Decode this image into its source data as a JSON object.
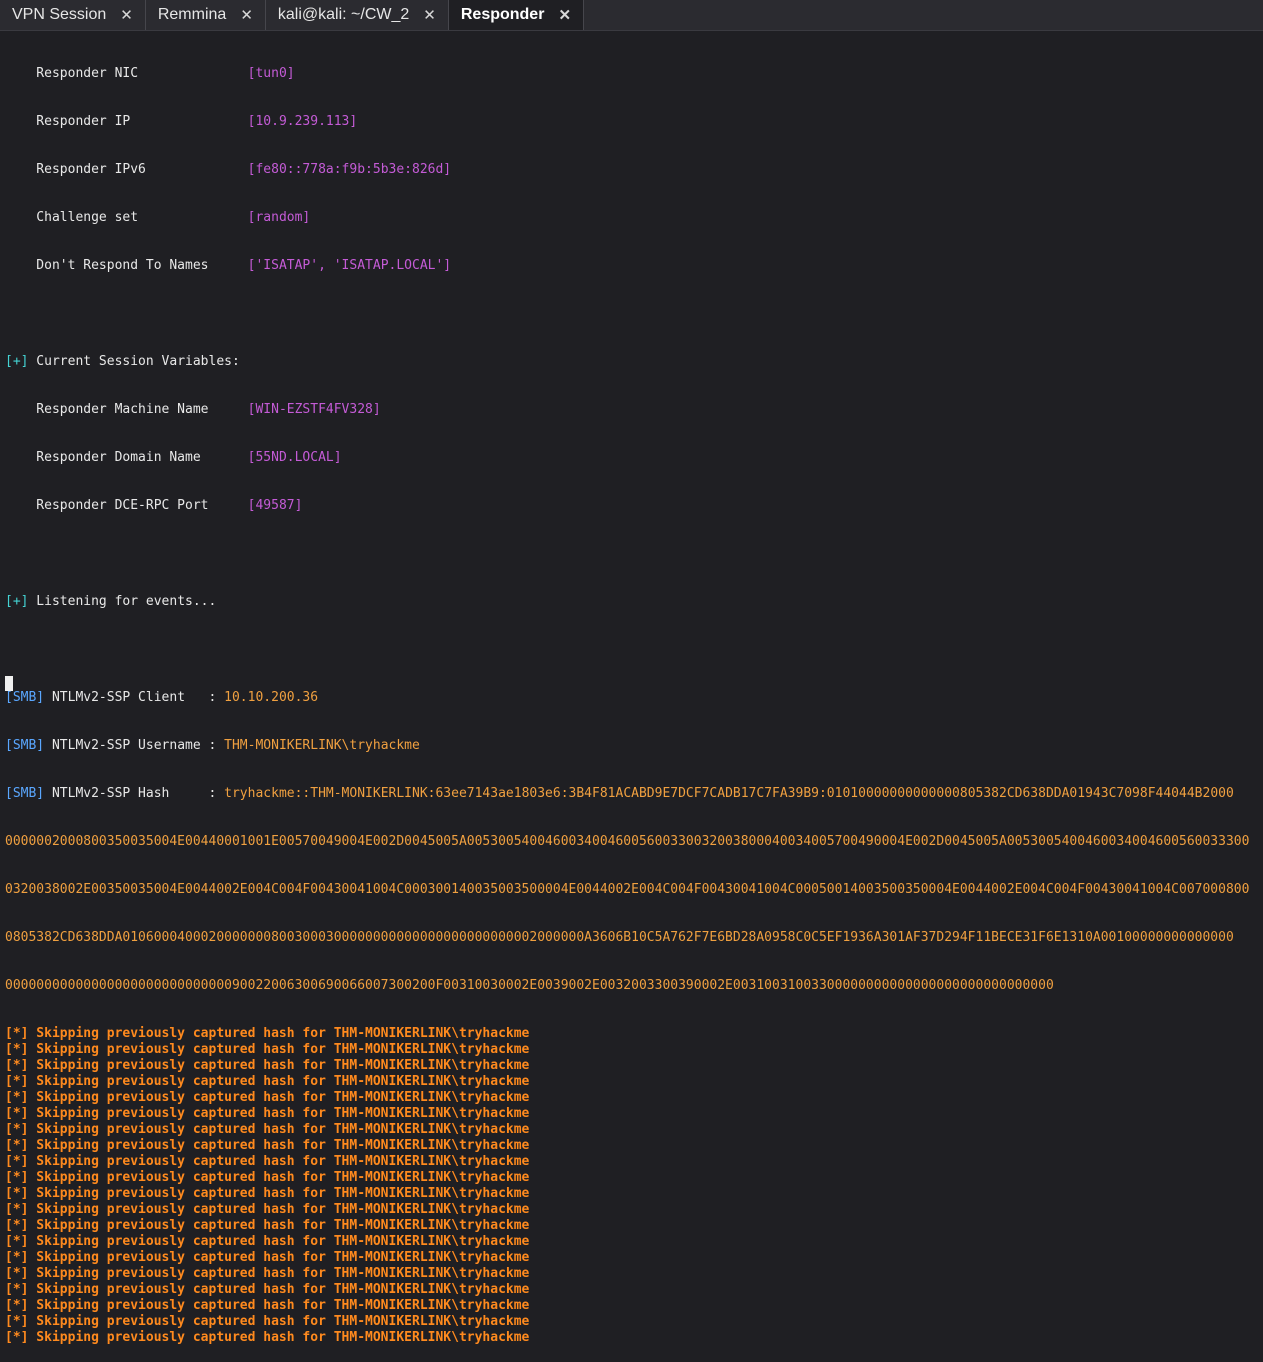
{
  "tabs": [
    {
      "label": "VPN Session",
      "active": false
    },
    {
      "label": "Remmina",
      "active": false
    },
    {
      "label": "kali@kali: ~/CW_2",
      "active": false
    },
    {
      "label": "Responder",
      "active": true
    }
  ],
  "close_glyph": "✕",
  "terminal": {
    "settings": [
      {
        "label": "    Responder NIC              ",
        "value": "[tun0]"
      },
      {
        "label": "    Responder IP               ",
        "value": "[10.9.239.113]"
      },
      {
        "label": "    Responder IPv6             ",
        "value": "[fe80::778a:f9b:5b3e:826d]"
      },
      {
        "label": "    Challenge set              ",
        "value": "[random]"
      },
      {
        "label": "    Don't Respond To Names     ",
        "value": "['ISATAP', 'ISATAP.LOCAL']"
      }
    ],
    "session_header_prefix": "[+]",
    "session_header_text": " Current Session Variables:",
    "session_vars": [
      {
        "label": "    Responder Machine Name     ",
        "value": "[WIN-EZSTF4FV328]"
      },
      {
        "label": "    Responder Domain Name      ",
        "value": "[55ND.LOCAL]"
      },
      {
        "label": "    Responder DCE-RPC Port     ",
        "value": "[49587]"
      }
    ],
    "listening_prefix": "[+]",
    "listening_text": " Listening for events...",
    "smb_tag": "[SMB]",
    "smb_client_label": " NTLMv2-SSP Client   : ",
    "smb_client_value": "10.10.200.36",
    "smb_user_label": " NTLMv2-SSP Username : ",
    "smb_user_value": "THM-MONIKERLINK\\tryhackme",
    "smb_hash_label": " NTLMv2-SSP Hash     : ",
    "hash_lines": [
      "tryhackme::THM-MONIKERLINK:63ee7143ae1803e6:3B4F81ACABD9E7DCF7CADB17C7FA39B9:01010000000000000805382CD638DDA01943C7098F44044B2000",
      "0000002000800350035004E00440001001E00570049004E002D0045005A00530054004600340046005600330032003800040034005700490004E002D0045005A0053005400460034004600560033300",
      "0320038002E00350035004E0044002E004C004F00430041004C000300140035003500004E0044002E004C004F00430041004C00050014003500350004E0044002E004C004F00430041004C007000800",
      "0805382CD638DDA01060004000200000008003000300000000000000000000000002000000A3606B10C5A762F7E6BD28A0958C0C5EF1936A301AF37D294F11BECE31F6E1310A00100000000000000",
      "0000000000000000000000000000090022006300690066007300200F00310030002E0039002E0032003300390002E00310031003300000000000000000000000000000"
    ],
    "skip_message": "[*] Skipping previously captured hash for THM-MONIKERLINK\\tryhackme",
    "skip_count": 20
  }
}
